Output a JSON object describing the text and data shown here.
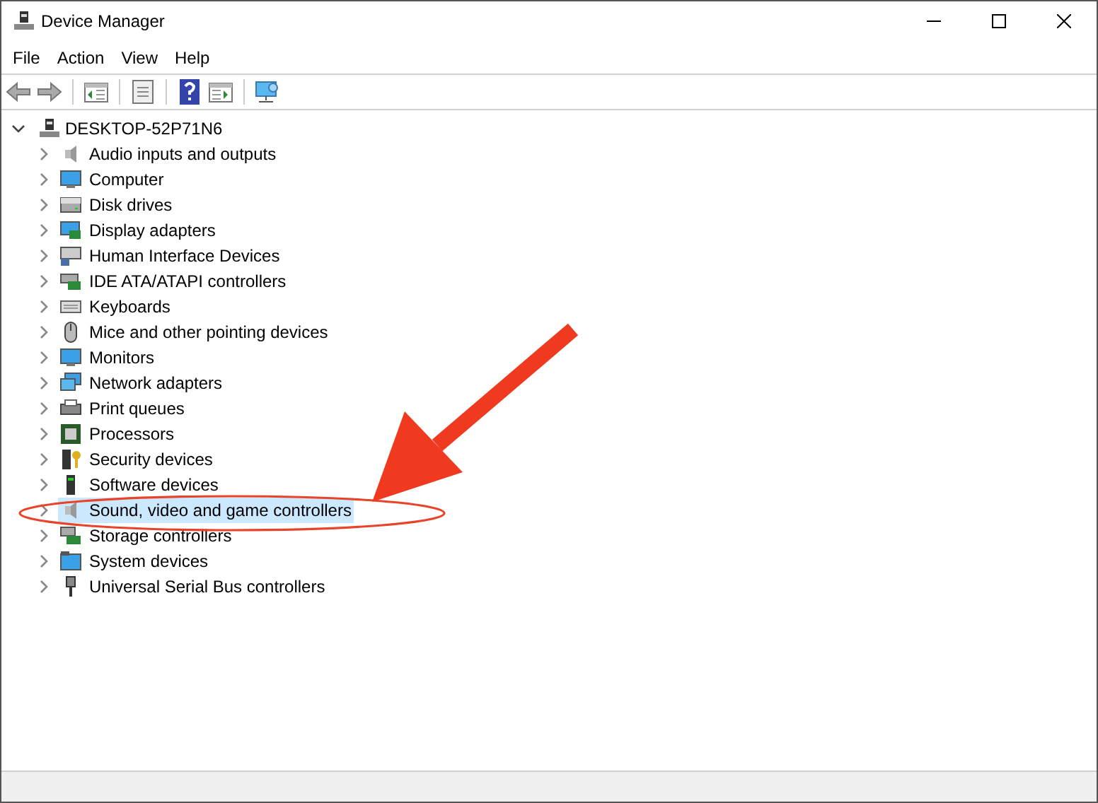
{
  "window": {
    "title": "Device Manager"
  },
  "menu": [
    "File",
    "Action",
    "View",
    "Help"
  ],
  "tree": {
    "label": "DESKTOP-52P71N6",
    "expanded": true,
    "selected": false,
    "children": [
      {
        "label": "Audio inputs and outputs",
        "expanded": false,
        "selected": false
      },
      {
        "label": "Computer",
        "expanded": false,
        "selected": false
      },
      {
        "label": "Disk drives",
        "expanded": false,
        "selected": false
      },
      {
        "label": "Display adapters",
        "expanded": false,
        "selected": false
      },
      {
        "label": "Human Interface Devices",
        "expanded": false,
        "selected": false
      },
      {
        "label": "IDE ATA/ATAPI controllers",
        "expanded": false,
        "selected": false
      },
      {
        "label": "Keyboards",
        "expanded": false,
        "selected": false
      },
      {
        "label": "Mice and other pointing devices",
        "expanded": false,
        "selected": false
      },
      {
        "label": "Monitors",
        "expanded": false,
        "selected": false
      },
      {
        "label": "Network adapters",
        "expanded": false,
        "selected": false
      },
      {
        "label": "Print queues",
        "expanded": false,
        "selected": false
      },
      {
        "label": "Processors",
        "expanded": false,
        "selected": false
      },
      {
        "label": "Security devices",
        "expanded": false,
        "selected": false
      },
      {
        "label": "Software devices",
        "expanded": false,
        "selected": false
      },
      {
        "label": "Sound, video and game controllers",
        "expanded": false,
        "selected": true
      },
      {
        "label": "Storage controllers",
        "expanded": false,
        "selected": false
      },
      {
        "label": "System devices",
        "expanded": false,
        "selected": false
      },
      {
        "label": "Universal Serial Bus controllers",
        "expanded": false,
        "selected": false
      }
    ]
  }
}
